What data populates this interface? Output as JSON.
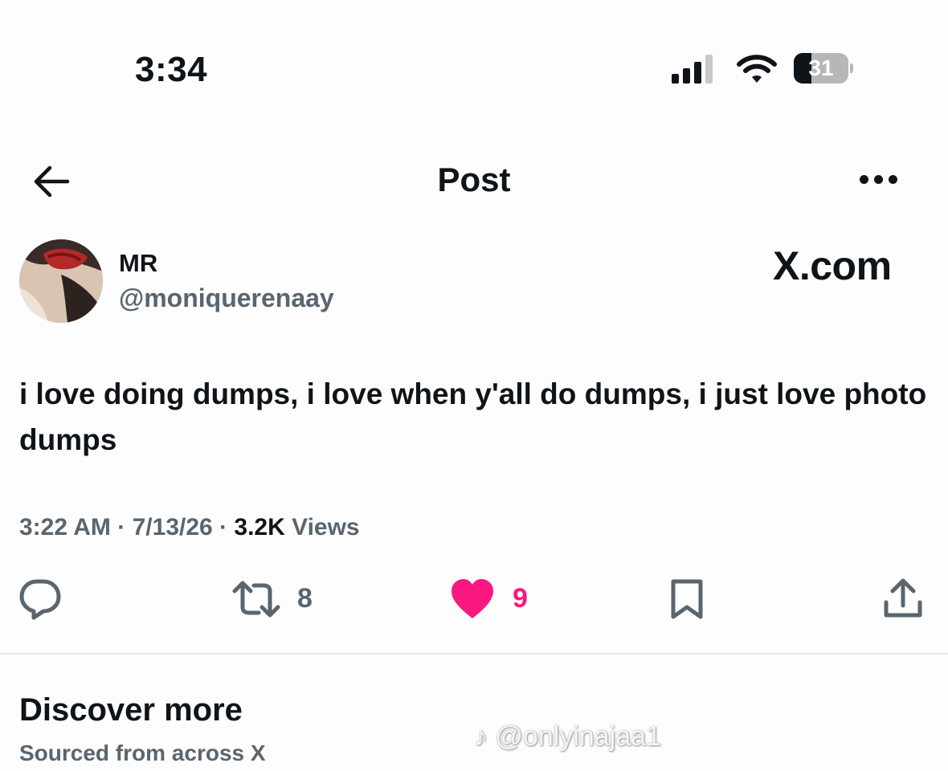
{
  "status_bar": {
    "time": "3:34",
    "battery": "31",
    "signal_icon": "cellular-signal-icon",
    "wifi_icon": "wifi-icon"
  },
  "header": {
    "title": "Post",
    "back_icon": "arrow-left-icon",
    "more_icon": "more-horizontal-icon"
  },
  "author": {
    "name": "MR",
    "handle": "@moniquerenaay"
  },
  "watermark_site": "X.com",
  "post": {
    "text": "i love doing dumps, i love when y'all do dumps, i just love photo dumps",
    "time": "3:22 AM",
    "date": "7/13/26",
    "views_count": "3.2K",
    "views_label": "Views",
    "separator": "·"
  },
  "actions": {
    "reply_icon": "reply-bubble-icon",
    "repost_icon": "repost-icon",
    "repost_count": "8",
    "like_icon": "heart-icon",
    "like_count": "9",
    "like_color": "#f91880",
    "bookmark_icon": "bookmark-icon",
    "share_icon": "share-icon"
  },
  "discover": {
    "title": "Discover more",
    "subtitle": "Sourced from across X"
  },
  "overlay_watermark": "@onlyinajaa1",
  "colors": {
    "text": "#0f1419",
    "secondary": "#59656f",
    "like": "#f91880",
    "background": "#fdfdfd"
  }
}
